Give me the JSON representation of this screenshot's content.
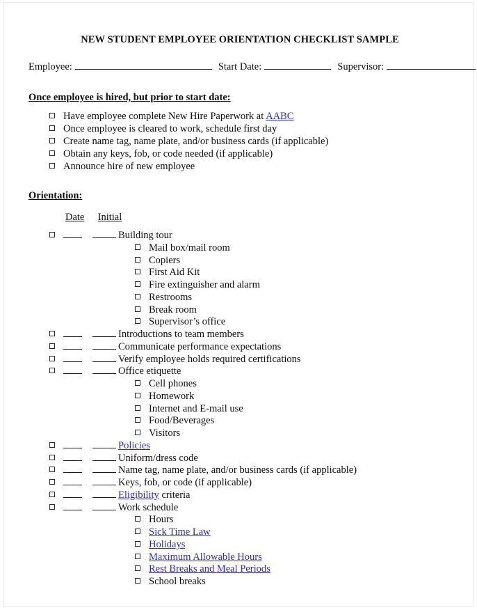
{
  "document": {
    "title": "NEW STUDENT EMPLOYEE ORIENTATION CHECKLIST SAMPLE",
    "link_color": "#2b2bbf",
    "text_color": "#0d0d0d"
  },
  "identity_line": {
    "employee_label": "Employee:",
    "employee_value": "",
    "start_date_label": "Start Date:",
    "start_date_value": "",
    "supervisor_label": "Supervisor:",
    "supervisor_value": ""
  },
  "prehire": {
    "heading": "Once employee is hired, but prior to start date:",
    "items": [
      {
        "text_before": "Have employee complete New Hire Paperwork at ",
        "link": "AABC",
        "text_after": ""
      },
      {
        "text_before": "Once employee is cleared to work, schedule first day",
        "link": "",
        "text_after": ""
      },
      {
        "text_before": "Create name tag, name plate, and/or business cards (if applicable)",
        "link": "",
        "text_after": ""
      },
      {
        "text_before": "Obtain any keys, fob, or code needed (if applicable)",
        "link": "",
        "text_after": ""
      },
      {
        "text_before": "Announce hire of new employee",
        "link": "",
        "text_after": ""
      }
    ]
  },
  "orientation": {
    "heading": "Orientation:",
    "columns": {
      "date": "Date",
      "initial": "Initial"
    },
    "rows": [
      {
        "date_value": "",
        "initial_value": "",
        "text_before": "Building tour",
        "link": "",
        "text_after": "",
        "children": [
          {
            "text_before": "Mail box/mail room",
            "link": "",
            "text_after": ""
          },
          {
            "text_before": "Copiers",
            "link": "",
            "text_after": ""
          },
          {
            "text_before": "First Aid Kit",
            "link": "",
            "text_after": ""
          },
          {
            "text_before": "Fire extinguisher and alarm",
            "link": "",
            "text_after": ""
          },
          {
            "text_before": "Restrooms",
            "link": "",
            "text_after": ""
          },
          {
            "text_before": "Break room",
            "link": "",
            "text_after": ""
          },
          {
            "text_before": "Supervisor’s office",
            "link": "",
            "text_after": ""
          }
        ]
      },
      {
        "date_value": "",
        "initial_value": "",
        "text_before": "Introductions to team members",
        "link": "",
        "text_after": "",
        "children": []
      },
      {
        "date_value": "",
        "initial_value": "",
        "text_before": "Communicate performance expectations",
        "link": "",
        "text_after": "",
        "children": []
      },
      {
        "date_value": "",
        "initial_value": "",
        "text_before": "Verify employee holds required certifications",
        "link": "",
        "text_after": "",
        "children": []
      },
      {
        "date_value": "",
        "initial_value": "",
        "text_before": "Office etiquette",
        "link": "",
        "text_after": "",
        "children": [
          {
            "text_before": "Cell phones",
            "link": "",
            "text_after": ""
          },
          {
            "text_before": "Homework",
            "link": "",
            "text_after": ""
          },
          {
            "text_before": "Internet and E-mail use",
            "link": "",
            "text_after": ""
          },
          {
            "text_before": "Food/Beverages",
            "link": "",
            "text_after": ""
          },
          {
            "text_before": "Visitors",
            "link": "",
            "text_after": ""
          }
        ]
      },
      {
        "date_value": "",
        "initial_value": "",
        "text_before": "",
        "link": "Policies",
        "text_after": "",
        "children": []
      },
      {
        "date_value": "",
        "initial_value": "",
        "text_before": "Uniform/dress code",
        "link": "",
        "text_after": "",
        "children": []
      },
      {
        "date_value": "",
        "initial_value": "",
        "text_before": "Name tag, name plate, and/or business cards (if applicable)",
        "link": "",
        "text_after": "",
        "children": []
      },
      {
        "date_value": "",
        "initial_value": "",
        "text_before": "Keys, fob, or code (if applicable)",
        "link": "",
        "text_after": "",
        "children": []
      },
      {
        "date_value": "",
        "initial_value": "",
        "text_before": "",
        "link": "Eligibility",
        "text_after": " criteria",
        "children": []
      },
      {
        "date_value": "",
        "initial_value": "",
        "text_before": "Work schedule",
        "link": "",
        "text_after": "",
        "children": [
          {
            "text_before": "Hours",
            "link": "",
            "text_after": ""
          },
          {
            "text_before": "",
            "link": "Sick Time Law",
            "text_after": ""
          },
          {
            "text_before": "",
            "link": "Holidays",
            "text_after": ""
          },
          {
            "text_before": "",
            "link": "Maximum Allowable Hours",
            "text_after": ""
          },
          {
            "text_before": "",
            "link": "Rest Breaks and Meal Periods",
            "text_after": ""
          },
          {
            "text_before": "School breaks",
            "link": "",
            "text_after": ""
          }
        ]
      }
    ]
  }
}
